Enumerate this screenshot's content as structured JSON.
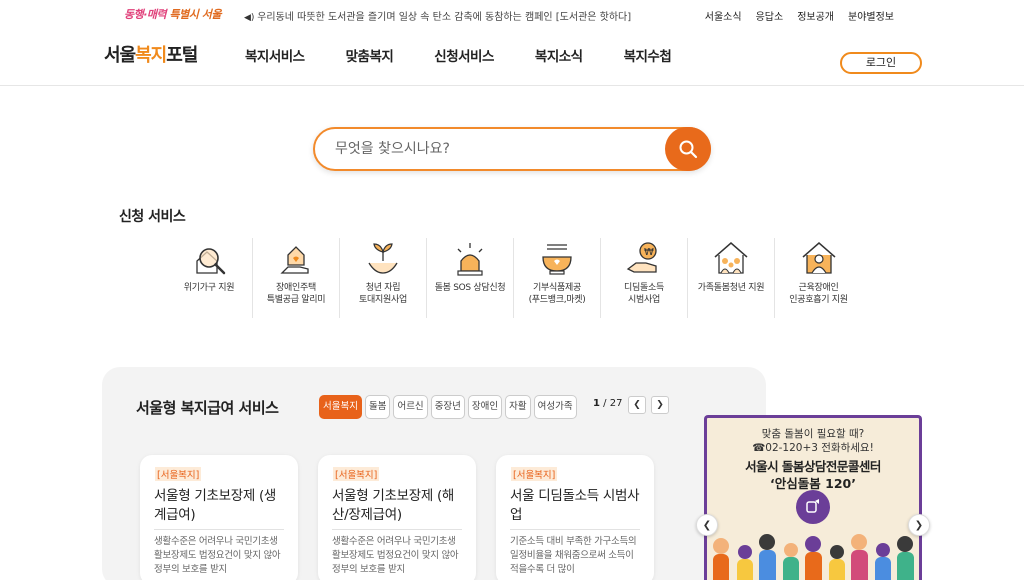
{
  "topbar": {
    "slogan_part1": "동행·매력",
    "slogan_part2": "특별시 서울",
    "notice": "우리동네 따뜻한 도서관을 즐기며 일상 속 탄소 감축에 동참하는 캠페인 [도서관은 핫하다]",
    "util_links": [
      "서울소식",
      "응답소",
      "정보공개",
      "분야별정보"
    ]
  },
  "header": {
    "brand_prefix": "서울",
    "brand_accent": "복지",
    "brand_suffix": "포털",
    "nav": [
      "복지서비스",
      "맞춤복지",
      "신청서비스",
      "복지소식",
      "복지수첩"
    ],
    "login": "로그인"
  },
  "search": {
    "placeholder": "무엇을 찾으시나요?"
  },
  "services": {
    "title": "신청 서비스",
    "items": [
      {
        "line1": "위기가구 지원",
        "line2": "",
        "icon": "magnifier-house-icon"
      },
      {
        "line1": "장애인주택",
        "line2": "특별공급 알리미",
        "icon": "house-hand-icon"
      },
      {
        "line1": "청년 자립",
        "line2": "토대지원사업",
        "icon": "sprout-hands-icon"
      },
      {
        "line1": "돌봄 SOS 상담신청",
        "line2": "",
        "icon": "siren-icon"
      },
      {
        "line1": "기부식품제공",
        "line2": "(푸드뱅크,마켓)",
        "icon": "bowl-icon"
      },
      {
        "line1": "디딤돌소득",
        "line2": "시범사업",
        "icon": "coin-hand-icon"
      },
      {
        "line1": "가족돌봄청년 지원",
        "line2": "",
        "icon": "family-house-icon"
      },
      {
        "line1": "근육장애인",
        "line2": "인공호흡기 지원",
        "icon": "person-house-icon"
      }
    ]
  },
  "benefits": {
    "title": "서울형 복지급여 서비스",
    "chips": [
      "서울복지",
      "돌봄",
      "어르신",
      "중장년",
      "장애인",
      "자활",
      "여성가족"
    ],
    "active_chip": "서울복지",
    "page_current": "1",
    "page_total": "/ 27",
    "cards": [
      {
        "tag": "[서울복지]",
        "title": "서울형 기초보장제 (생계급여)",
        "desc": "생활수준은 어려우나 국민기초생활보장제도 법정요건이 맞지 않아 정부의 보호를 받지"
      },
      {
        "tag": "[서울복지]",
        "title": "서울형 기초보장제 (해산/장제급여)",
        "desc": "생활수준은 어려우나 국민기초생활보장제도 법정요건이 맞지 않아 정부의 보호를 받지"
      },
      {
        "tag": "[서울복지]",
        "title": "서울 디딤돌소득 시범사업",
        "desc": "기준소득 대비 부족한 가구소득의 일정비율을 채워줌으로써 소득이 적을수록 더 많이"
      }
    ]
  },
  "banner": {
    "line1": "맞춤 돌봄이 필요할 때?",
    "line2": "☎02-120+3 전화하세요!",
    "line3": "서울시 돌봄상담전문콜센터",
    "line4": "‘안심돌봄 120’"
  },
  "colors": {
    "accent": "#e8621a",
    "brand_orange": "#f08a1c",
    "banner_purple": "#6b3e98"
  }
}
